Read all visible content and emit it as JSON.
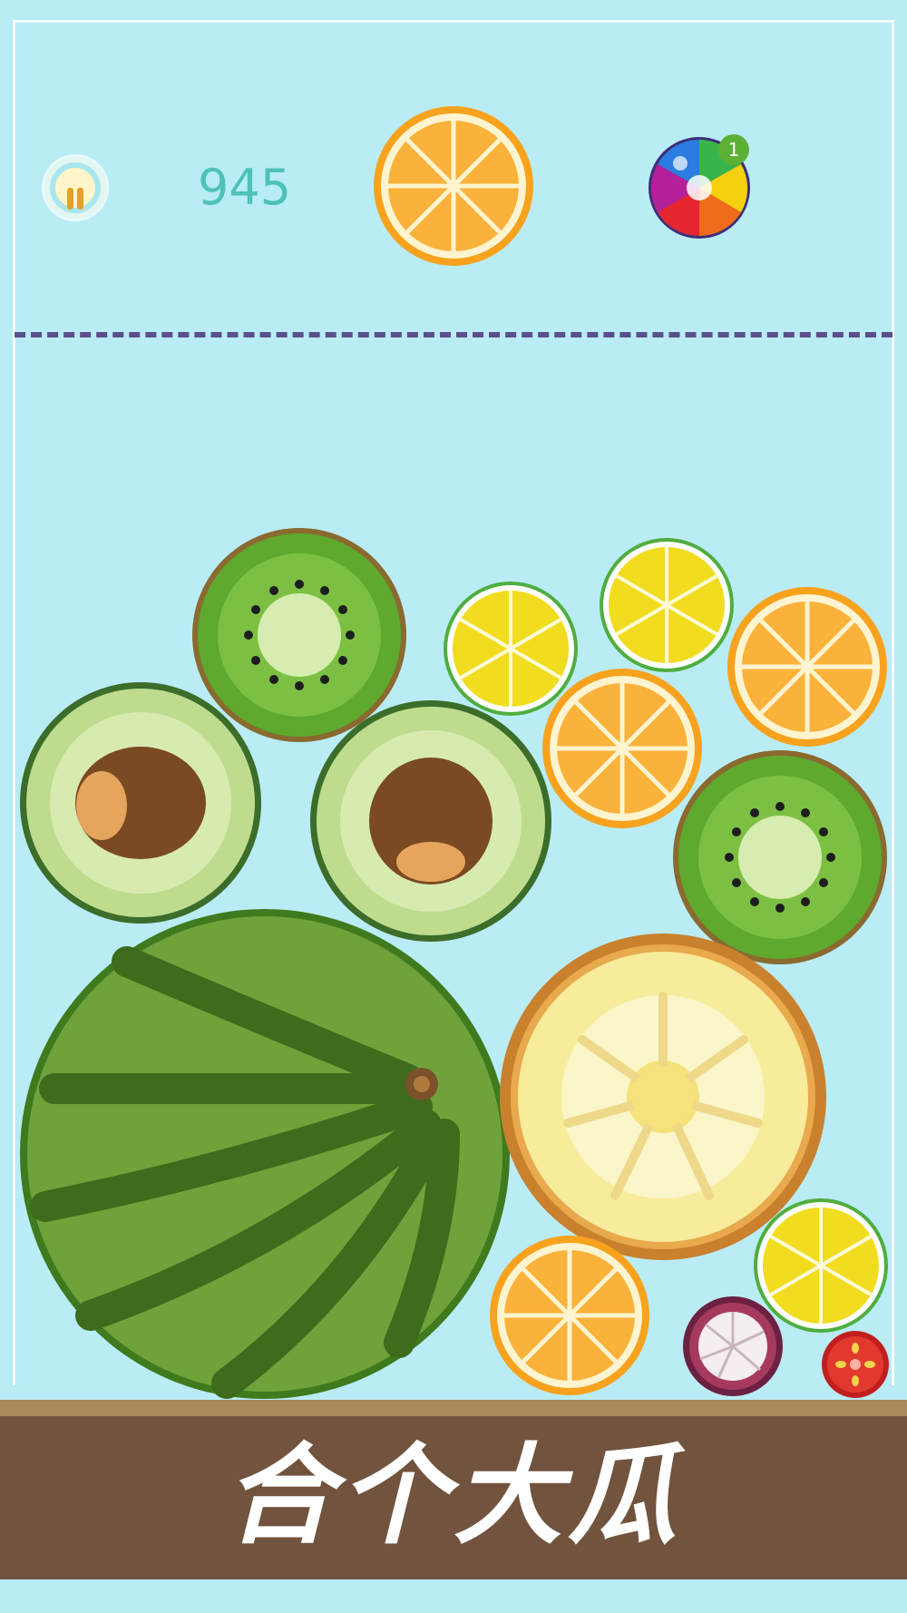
{
  "hud": {
    "score": "945",
    "powerup_count": "1",
    "next_fruit": "orange"
  },
  "title": "合个大瓜",
  "board": {
    "fruits": [
      "kiwi",
      "lemon",
      "lemon",
      "orange",
      "avocado",
      "avocado",
      "orange",
      "kiwi",
      "watermelon",
      "pineapple",
      "lemon",
      "orange",
      "mangosteen",
      "tomato"
    ]
  },
  "colors": {
    "background": "#b9ecf5",
    "score": "#4dc2b7",
    "ground": "#71533e",
    "ground_top": "#a98859",
    "dashed_line": "#5b4f8c",
    "powerup_badge": "#5db036"
  }
}
